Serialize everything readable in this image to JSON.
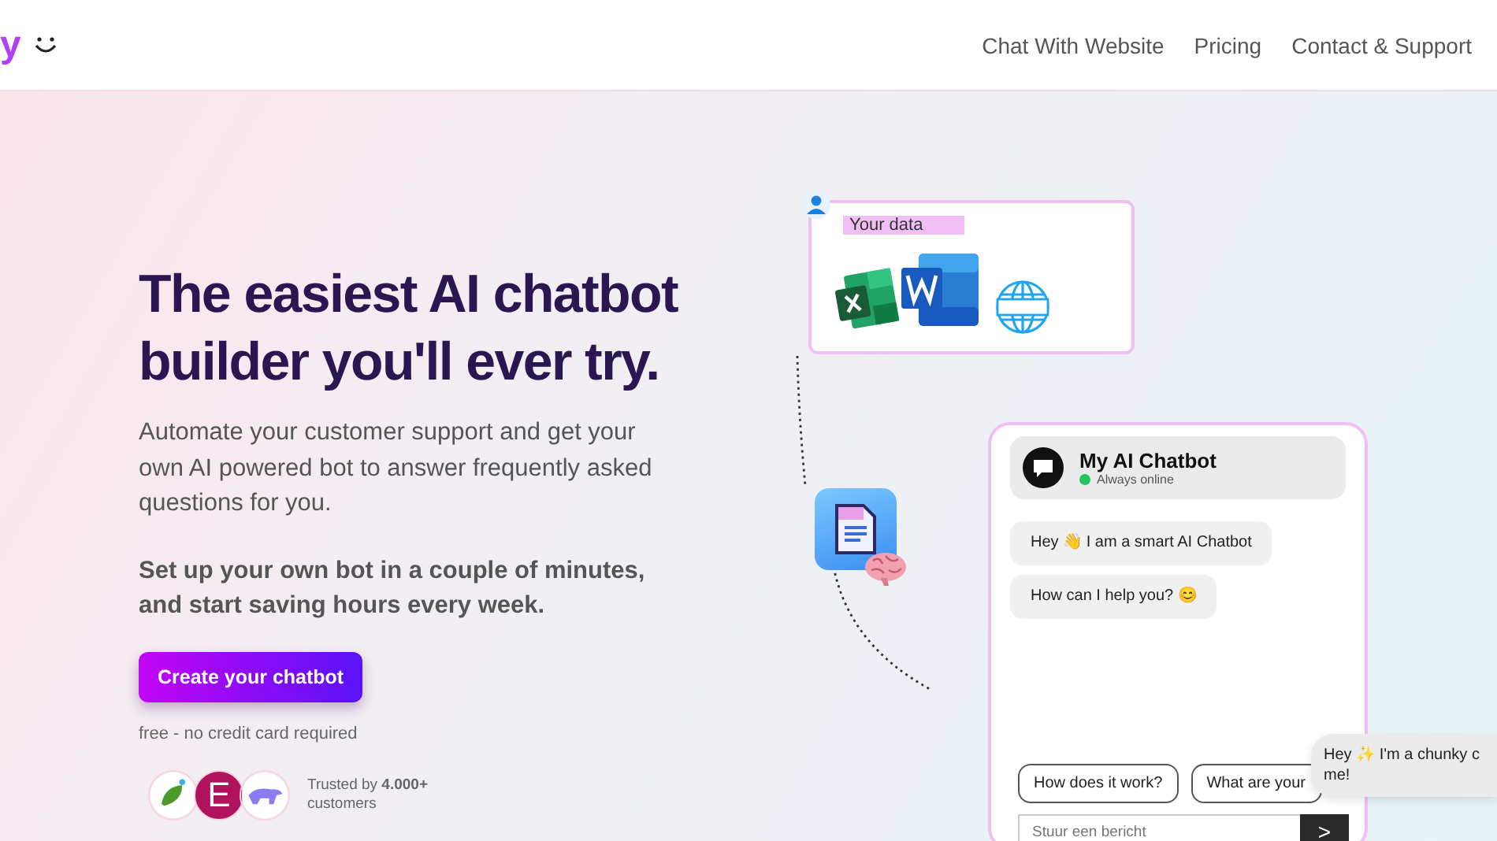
{
  "header": {
    "logo": "y",
    "nav": [
      "Chat With Website",
      "Pricing",
      "Contact & Support"
    ]
  },
  "hero": {
    "title": "The easiest AI chatbot builder you'll ever try.",
    "intro": "Automate your customer support and get your own AI powered bot to answer frequently asked questions for you.",
    "highlight": "Set up your own bot in a couple of minutes, and start saving hours every week.",
    "cta": "Create your chatbot",
    "note": "free - no credit card required",
    "customer_logo_letter": "E",
    "trusted": "Trusted by **4.000+** customers"
  },
  "illustration": {
    "data_label": "Your data",
    "chatbot": {
      "name": "My AI Chatbot",
      "status": "Always online",
      "online": true,
      "messages": [
        "Hey 👋 I am a smart AI Chatbot",
        "How can I help you? 😊"
      ],
      "suggestions": [
        "How does it work?",
        "What are your"
      ],
      "input_placeholder": "Stuur een bericht",
      "send": ">"
    },
    "popup": "Hey ✨ I'm a chunky c\nme!"
  }
}
